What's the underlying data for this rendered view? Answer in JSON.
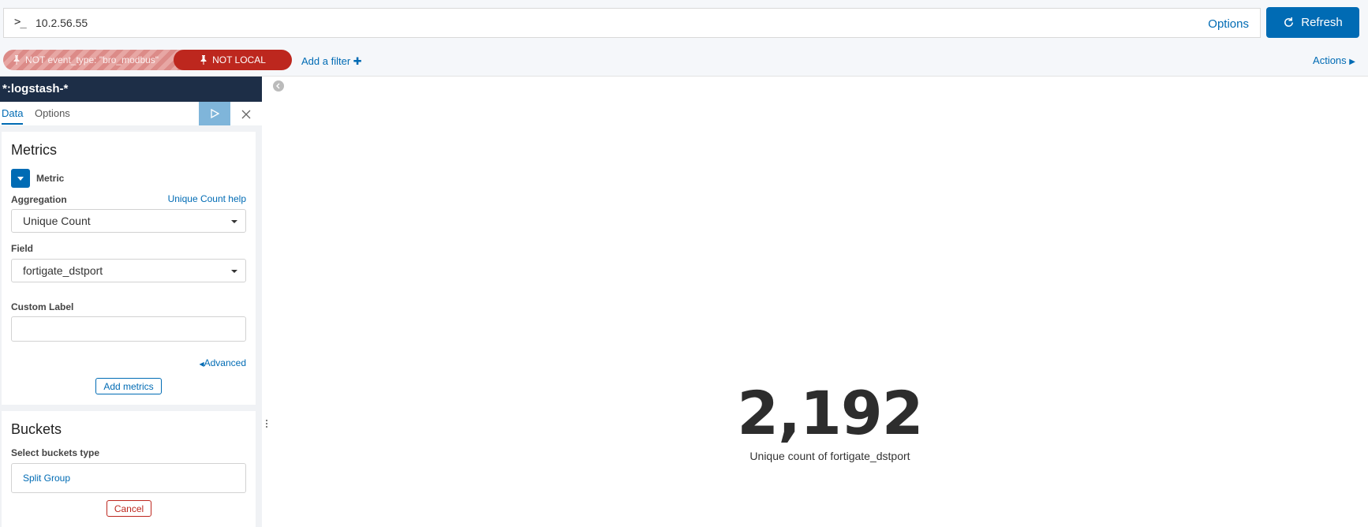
{
  "query": {
    "prompt_symbol": ">_",
    "value": "10.2.56.55",
    "options_label": "Options",
    "refresh_label": "Refresh"
  },
  "filters": {
    "pills": [
      {
        "label": "NOT event_type: \"bro_modbus\"",
        "state": "disabled"
      },
      {
        "label": "NOT LOCAL",
        "state": "active"
      }
    ],
    "add_filter_label": "Add a filter",
    "actions_label": "Actions"
  },
  "editor": {
    "index_pattern": "*:logstash-*",
    "tabs": [
      {
        "label": "Data",
        "active": true
      },
      {
        "label": "Options",
        "active": false
      }
    ],
    "metrics": {
      "title": "Metrics",
      "metric_label": "Metric",
      "aggregation_label": "Aggregation",
      "aggregation_help": "Unique Count help",
      "aggregation_value": "Unique Count",
      "field_label": "Field",
      "field_value": "fortigate_dstport",
      "custom_label_label": "Custom Label",
      "custom_label_value": "",
      "advanced_label": "Advanced",
      "add_metrics_label": "Add metrics"
    },
    "buckets": {
      "title": "Buckets",
      "select_type_label": "Select buckets type",
      "split_group_label": "Split Group",
      "cancel_label": "Cancel"
    }
  },
  "visualization": {
    "value": "2,192",
    "label": "Unique count of fortigate_dstport"
  },
  "colors": {
    "accent": "#006bb4",
    "danger": "#bd271e",
    "header_dark": "#1d2e47"
  }
}
